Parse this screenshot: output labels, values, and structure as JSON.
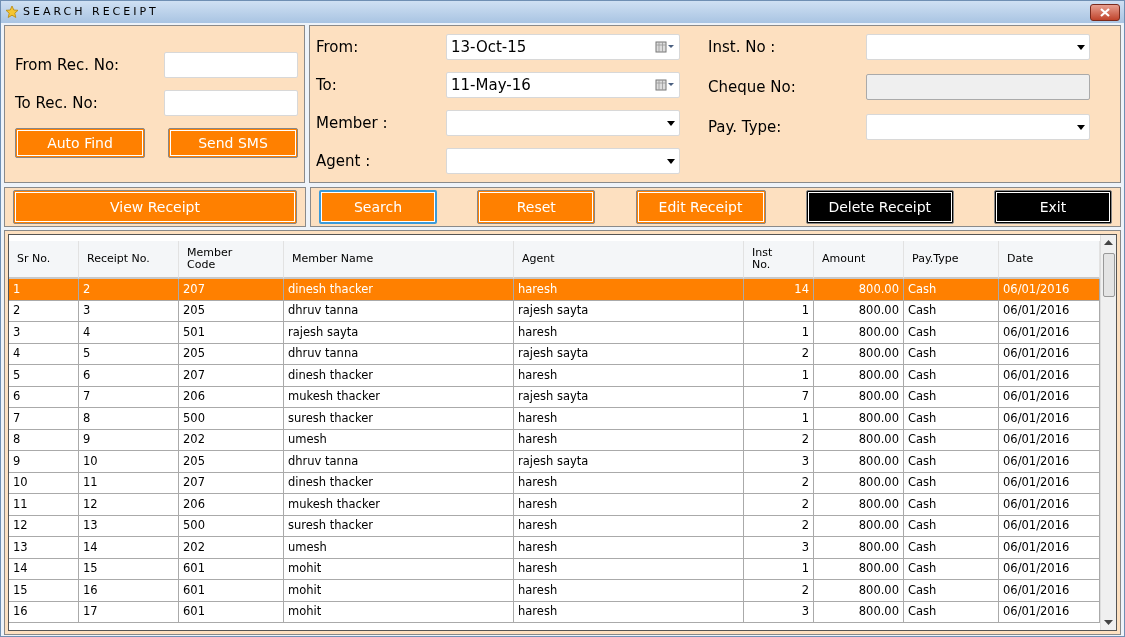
{
  "window": {
    "title": "SEARCH RECEIPT"
  },
  "receipt_range": {
    "fields": [
      {
        "label": "From Rec. No:"
      },
      {
        "label": "To Rec. No:"
      }
    ],
    "buttons": [
      {
        "label": "Auto Find"
      },
      {
        "label": "Send SMS"
      }
    ]
  },
  "filters": {
    "left_fields": [
      {
        "label": "From:",
        "kind": "date",
        "value": "13-Oct-15",
        "disabled": false
      },
      {
        "label": "To:",
        "kind": "date",
        "value": "11-May-16",
        "disabled": false
      },
      {
        "label": "Member :",
        "kind": "select",
        "disabled": false
      },
      {
        "label": "Agent :",
        "kind": "select",
        "disabled": false
      }
    ],
    "right_fields": [
      {
        "label": "Inst. No :",
        "kind": "select",
        "disabled": false
      },
      {
        "label": "Cheque No:",
        "kind": "text",
        "disabled": true
      },
      {
        "label": "Pay. Type:",
        "kind": "select",
        "disabled": false
      }
    ]
  },
  "view_button": {
    "label": "View Receipt"
  },
  "actions": [
    {
      "label": "Search",
      "color": "#ff8000",
      "focused": true
    },
    {
      "label": "Reset",
      "color": "#ff8000",
      "focused": false
    },
    {
      "label": "Edit Receipt",
      "color": "#ff8000",
      "focused": false
    },
    {
      "label": "Delete Receipt",
      "color": "#000000",
      "focused": false
    },
    {
      "label": "Exit",
      "color": "#000000",
      "focused": false
    }
  ],
  "table": {
    "columns": [
      {
        "label": "Sr No.",
        "numeric": false
      },
      {
        "label": "Receipt No.",
        "numeric": false
      },
      {
        "label": "Member\nCode",
        "numeric": false
      },
      {
        "label": "Member Name",
        "numeric": false
      },
      {
        "label": "Agent",
        "numeric": false
      },
      {
        "label": "Inst\nNo.",
        "numeric": true
      },
      {
        "label": "Amount",
        "numeric": true
      },
      {
        "label": "Pay.Type",
        "numeric": false
      },
      {
        "label": "Date",
        "numeric": false
      }
    ],
    "rows": [
      {
        "selected": true,
        "cells": [
          "1",
          "2",
          "207",
          "dinesh thacker",
          "haresh",
          "14",
          "800.00",
          "Cash",
          "06/01/2016"
        ]
      },
      {
        "selected": false,
        "cells": [
          "2",
          "3",
          "205",
          "dhruv tanna",
          "rajesh sayta",
          "1",
          "800.00",
          "Cash",
          "06/01/2016"
        ]
      },
      {
        "selected": false,
        "cells": [
          "3",
          "4",
          "501",
          "rajesh sayta",
          "haresh",
          "1",
          "800.00",
          "Cash",
          "06/01/2016"
        ]
      },
      {
        "selected": false,
        "cells": [
          "4",
          "5",
          "205",
          "dhruv tanna",
          "rajesh sayta",
          "2",
          "800.00",
          "Cash",
          "06/01/2016"
        ]
      },
      {
        "selected": false,
        "cells": [
          "5",
          "6",
          "207",
          "dinesh thacker",
          "haresh",
          "1",
          "800.00",
          "Cash",
          "06/01/2016"
        ]
      },
      {
        "selected": false,
        "cells": [
          "6",
          "7",
          "206",
          "mukesh thacker",
          "rajesh sayta",
          "7",
          "800.00",
          "Cash",
          "06/01/2016"
        ]
      },
      {
        "selected": false,
        "cells": [
          "7",
          "8",
          "500",
          "suresh thacker",
          "haresh",
          "1",
          "800.00",
          "Cash",
          "06/01/2016"
        ]
      },
      {
        "selected": false,
        "cells": [
          "8",
          "9",
          "202",
          "umesh",
          "haresh",
          "2",
          "800.00",
          "Cash",
          "06/01/2016"
        ]
      },
      {
        "selected": false,
        "cells": [
          "9",
          "10",
          "205",
          "dhruv tanna",
          "rajesh sayta",
          "3",
          "800.00",
          "Cash",
          "06/01/2016"
        ]
      },
      {
        "selected": false,
        "cells": [
          "10",
          "11",
          "207",
          "dinesh thacker",
          "haresh",
          "2",
          "800.00",
          "Cash",
          "06/01/2016"
        ]
      },
      {
        "selected": false,
        "cells": [
          "11",
          "12",
          "206",
          "mukesh thacker",
          "haresh",
          "2",
          "800.00",
          "Cash",
          "06/01/2016"
        ]
      },
      {
        "selected": false,
        "cells": [
          "12",
          "13",
          "500",
          "suresh thacker",
          "haresh",
          "2",
          "800.00",
          "Cash",
          "06/01/2016"
        ]
      },
      {
        "selected": false,
        "cells": [
          "13",
          "14",
          "202",
          "umesh",
          "haresh",
          "3",
          "800.00",
          "Cash",
          "06/01/2016"
        ]
      },
      {
        "selected": false,
        "cells": [
          "14",
          "15",
          "601",
          "mohit",
          "haresh",
          "1",
          "800.00",
          "Cash",
          "06/01/2016"
        ]
      },
      {
        "selected": false,
        "cells": [
          "15",
          "16",
          "601",
          "mohit",
          "haresh",
          "2",
          "800.00",
          "Cash",
          "06/01/2016"
        ]
      },
      {
        "selected": false,
        "cells": [
          "16",
          "17",
          "601",
          "mohit",
          "haresh",
          "3",
          "800.00",
          "Cash",
          "06/01/2016"
        ]
      }
    ]
  }
}
